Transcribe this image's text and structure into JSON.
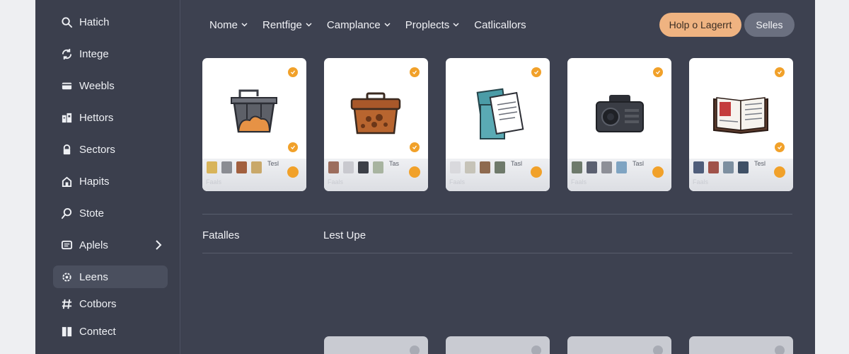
{
  "sidebar": {
    "items": [
      {
        "label": "Hatich",
        "icon": "search-icon",
        "active": false
      },
      {
        "label": "Intege",
        "icon": "refresh-icon",
        "active": false
      },
      {
        "label": "Weebls",
        "icon": "folder-icon",
        "active": false
      },
      {
        "label": "Hettors",
        "icon": "buildings-icon",
        "active": false
      },
      {
        "label": "Sectors",
        "icon": "lock-icon",
        "active": false
      },
      {
        "label": "Hapits",
        "icon": "house-icon",
        "active": false
      },
      {
        "label": "Stote",
        "icon": "magnifier-icon",
        "active": false
      },
      {
        "label": "Aplels",
        "icon": "message-icon",
        "active": false
      },
      {
        "label": "Leens",
        "icon": "gear-icon",
        "active": true
      },
      {
        "label": "Cotbors",
        "icon": "hash-icon",
        "active": false
      },
      {
        "label": "Contect",
        "icon": "book-icon",
        "active": false
      }
    ]
  },
  "topnav": {
    "items": [
      {
        "label": "Nome",
        "dropdown": true
      },
      {
        "label": "Rentfige",
        "dropdown": true
      },
      {
        "label": "Camplance",
        "dropdown": true
      },
      {
        "label": "Proplects",
        "dropdown": true
      },
      {
        "label": "Catlicallors",
        "dropdown": false
      }
    ]
  },
  "header": {
    "primary_button": "Holp o Lagerrt",
    "secondary_button": "Selles"
  },
  "cards": [
    {
      "illustration": "basket-icon",
      "note": "Tesl",
      "sub": "Faals"
    },
    {
      "illustration": "chest-icon",
      "note": "Tas",
      "sub": "Faals"
    },
    {
      "illustration": "documents-icon",
      "note": "Tasl",
      "sub": "Faals"
    },
    {
      "illustration": "camera-icon",
      "note": "Tasl",
      "sub": "Faals"
    },
    {
      "illustration": "open-book-icon",
      "note": "Tesl",
      "sub": "Faals"
    }
  ],
  "sections": {
    "left_label": "Fatalles",
    "right_label": "Lest Upe"
  },
  "colors": {
    "accent": "#f1a12a",
    "primary_button_bg": "#efb381",
    "panel_bg": "#3d4150",
    "page_bg": "#eeeff2"
  }
}
